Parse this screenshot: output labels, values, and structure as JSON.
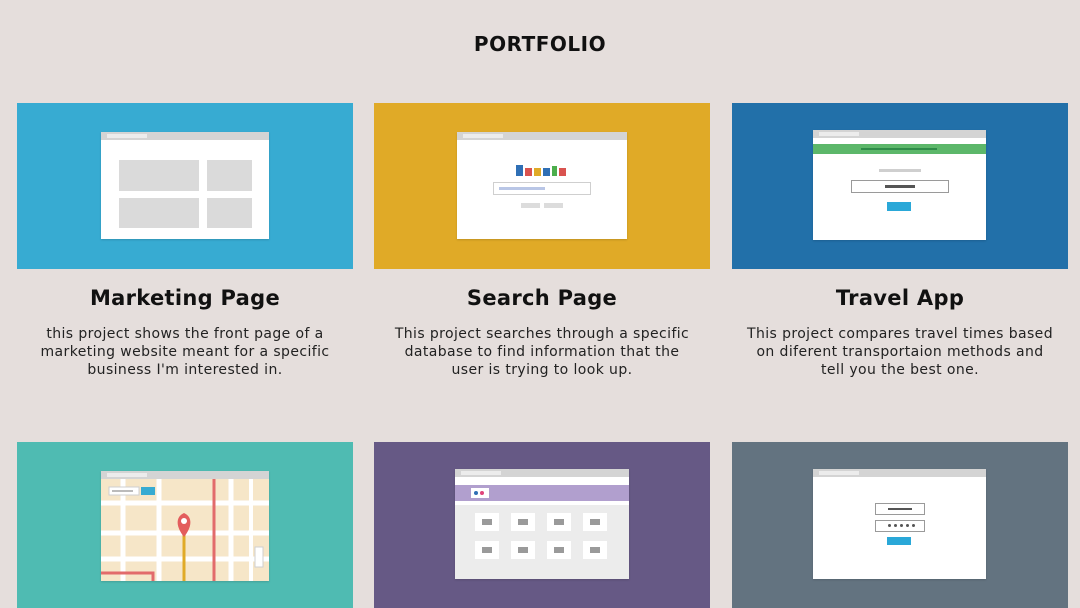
{
  "header": {
    "title": "PORTFOLIO"
  },
  "colors": {
    "background": "#e5dedc",
    "marketing": "#37abd2",
    "search": "#e0aa27",
    "travel": "#2270a9",
    "map": "#4fbbb2",
    "gallery": "#665985",
    "login": "#637380"
  },
  "projects": [
    {
      "title": "Marketing Page",
      "description": "this project shows the front page of a marketing website meant for a specific business I'm interested in.",
      "thumbnail": "marketing-layout-illustration"
    },
    {
      "title": "Search Page",
      "description": "This project searches through a specific database to find information that the user is trying to look up.",
      "thumbnail": "search-page-illustration"
    },
    {
      "title": "Travel App",
      "description": "This project compares travel times based on diferent transportaion methods and tell you the best one.",
      "thumbnail": "travel-app-illustration"
    },
    {
      "thumbnail": "map-illustration"
    },
    {
      "thumbnail": "image-gallery-illustration"
    },
    {
      "thumbnail": "login-form-illustration"
    }
  ]
}
